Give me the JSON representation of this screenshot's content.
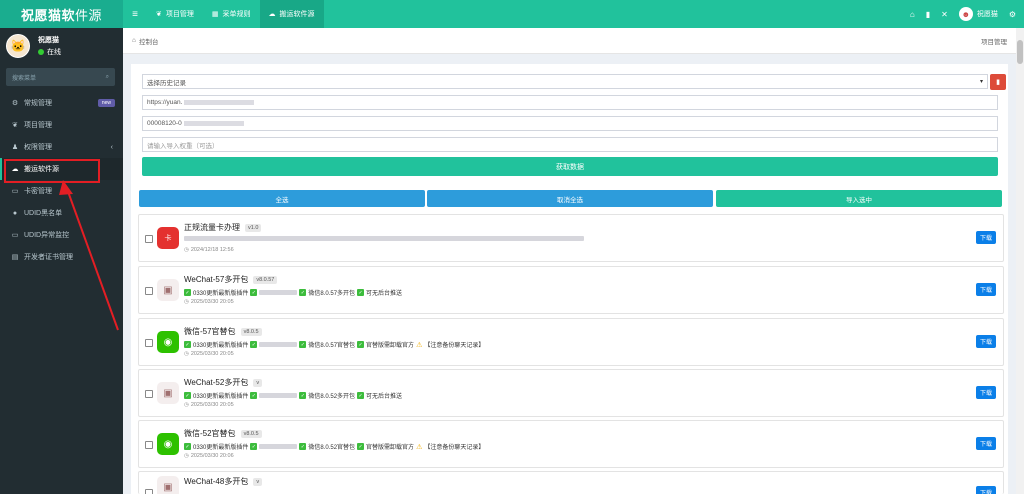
{
  "app": {
    "logo_main": "祝愿猫软",
    "logo_tail": "件源"
  },
  "topnav": {
    "items": [
      {
        "label": "项目管理",
        "icon": "leaf-icon"
      },
      {
        "label": "采单规则",
        "icon": "grid-icon"
      },
      {
        "label": "搬运软件源",
        "icon": "cloud-icon",
        "active": true
      }
    ],
    "user": "祝愿猫"
  },
  "sidebar": {
    "profile": {
      "name": "祝愿猫",
      "status": "在线"
    },
    "search_placeholder": "搜索菜单",
    "items": [
      {
        "label": "常规管理",
        "badge": "new"
      },
      {
        "label": "项目管理"
      },
      {
        "label": "权限管理",
        "chevron": "‹"
      },
      {
        "label": "搬运软件源",
        "active": true
      },
      {
        "label": "卡密管理"
      },
      {
        "label": "UDID黑名单"
      },
      {
        "label": "UDID异常监控"
      },
      {
        "label": "开发者证书管理"
      }
    ]
  },
  "breadcrumb": {
    "home": "控制台",
    "right": "项目管理"
  },
  "form": {
    "history_select": "选择历史记录",
    "url_value": "https://yuan.",
    "code_value": "00008120-0",
    "weight_placeholder": "请输入导入权重（可选）",
    "fetch_label": "获取数据"
  },
  "actions": {
    "select_all": "全选",
    "deselect": "取消全选",
    "import": "导入选中"
  },
  "colors": {
    "accent": "#21c29c",
    "primary": "#2d9cdb",
    "danger": "#dd4b39",
    "sidebar": "#222d32"
  },
  "list": [
    {
      "title": "正规流量卡办理",
      "version": "v1.0",
      "desc": "",
      "time": "2024/12/18 12:56",
      "download": "下载"
    },
    {
      "title": "WeChat-57多开包",
      "version": "v8.0.57",
      "d1": "0330更新最新版插件",
      "d2": "微信8.0.57多开包",
      "d3": "可无后台推送",
      "time": "2025/03/30 20:05",
      "download": "下载"
    },
    {
      "title": "微信-57官替包",
      "version": "v8.0.5",
      "d1": "0330更新最新版插件",
      "d2": "微信8.0.57官替包",
      "d3": "官替版需卸载官方",
      "d4": "【注意备份聊天记录】",
      "time": "2025/03/30 20:05",
      "download": "下载"
    },
    {
      "title": "WeChat-52多开包",
      "version": "v",
      "d1": "0330更新最新版插件",
      "d2": "微信8.0.52多开包",
      "d3": "可无后台推送",
      "time": "2025/03/30 20:05",
      "download": "下载"
    },
    {
      "title": "微信-52官替包",
      "version": "v8.0.5",
      "d1": "0330更新最新版插件",
      "d2": "微信8.0.52官替包",
      "d3": "官替版需卸载官方",
      "d4": "【注意备份聊天记录】",
      "time": "2025/03/30 20:06",
      "download": "下载"
    },
    {
      "title": "WeChat-48多开包",
      "version": "v",
      "time": "",
      "download": "下载"
    }
  ]
}
